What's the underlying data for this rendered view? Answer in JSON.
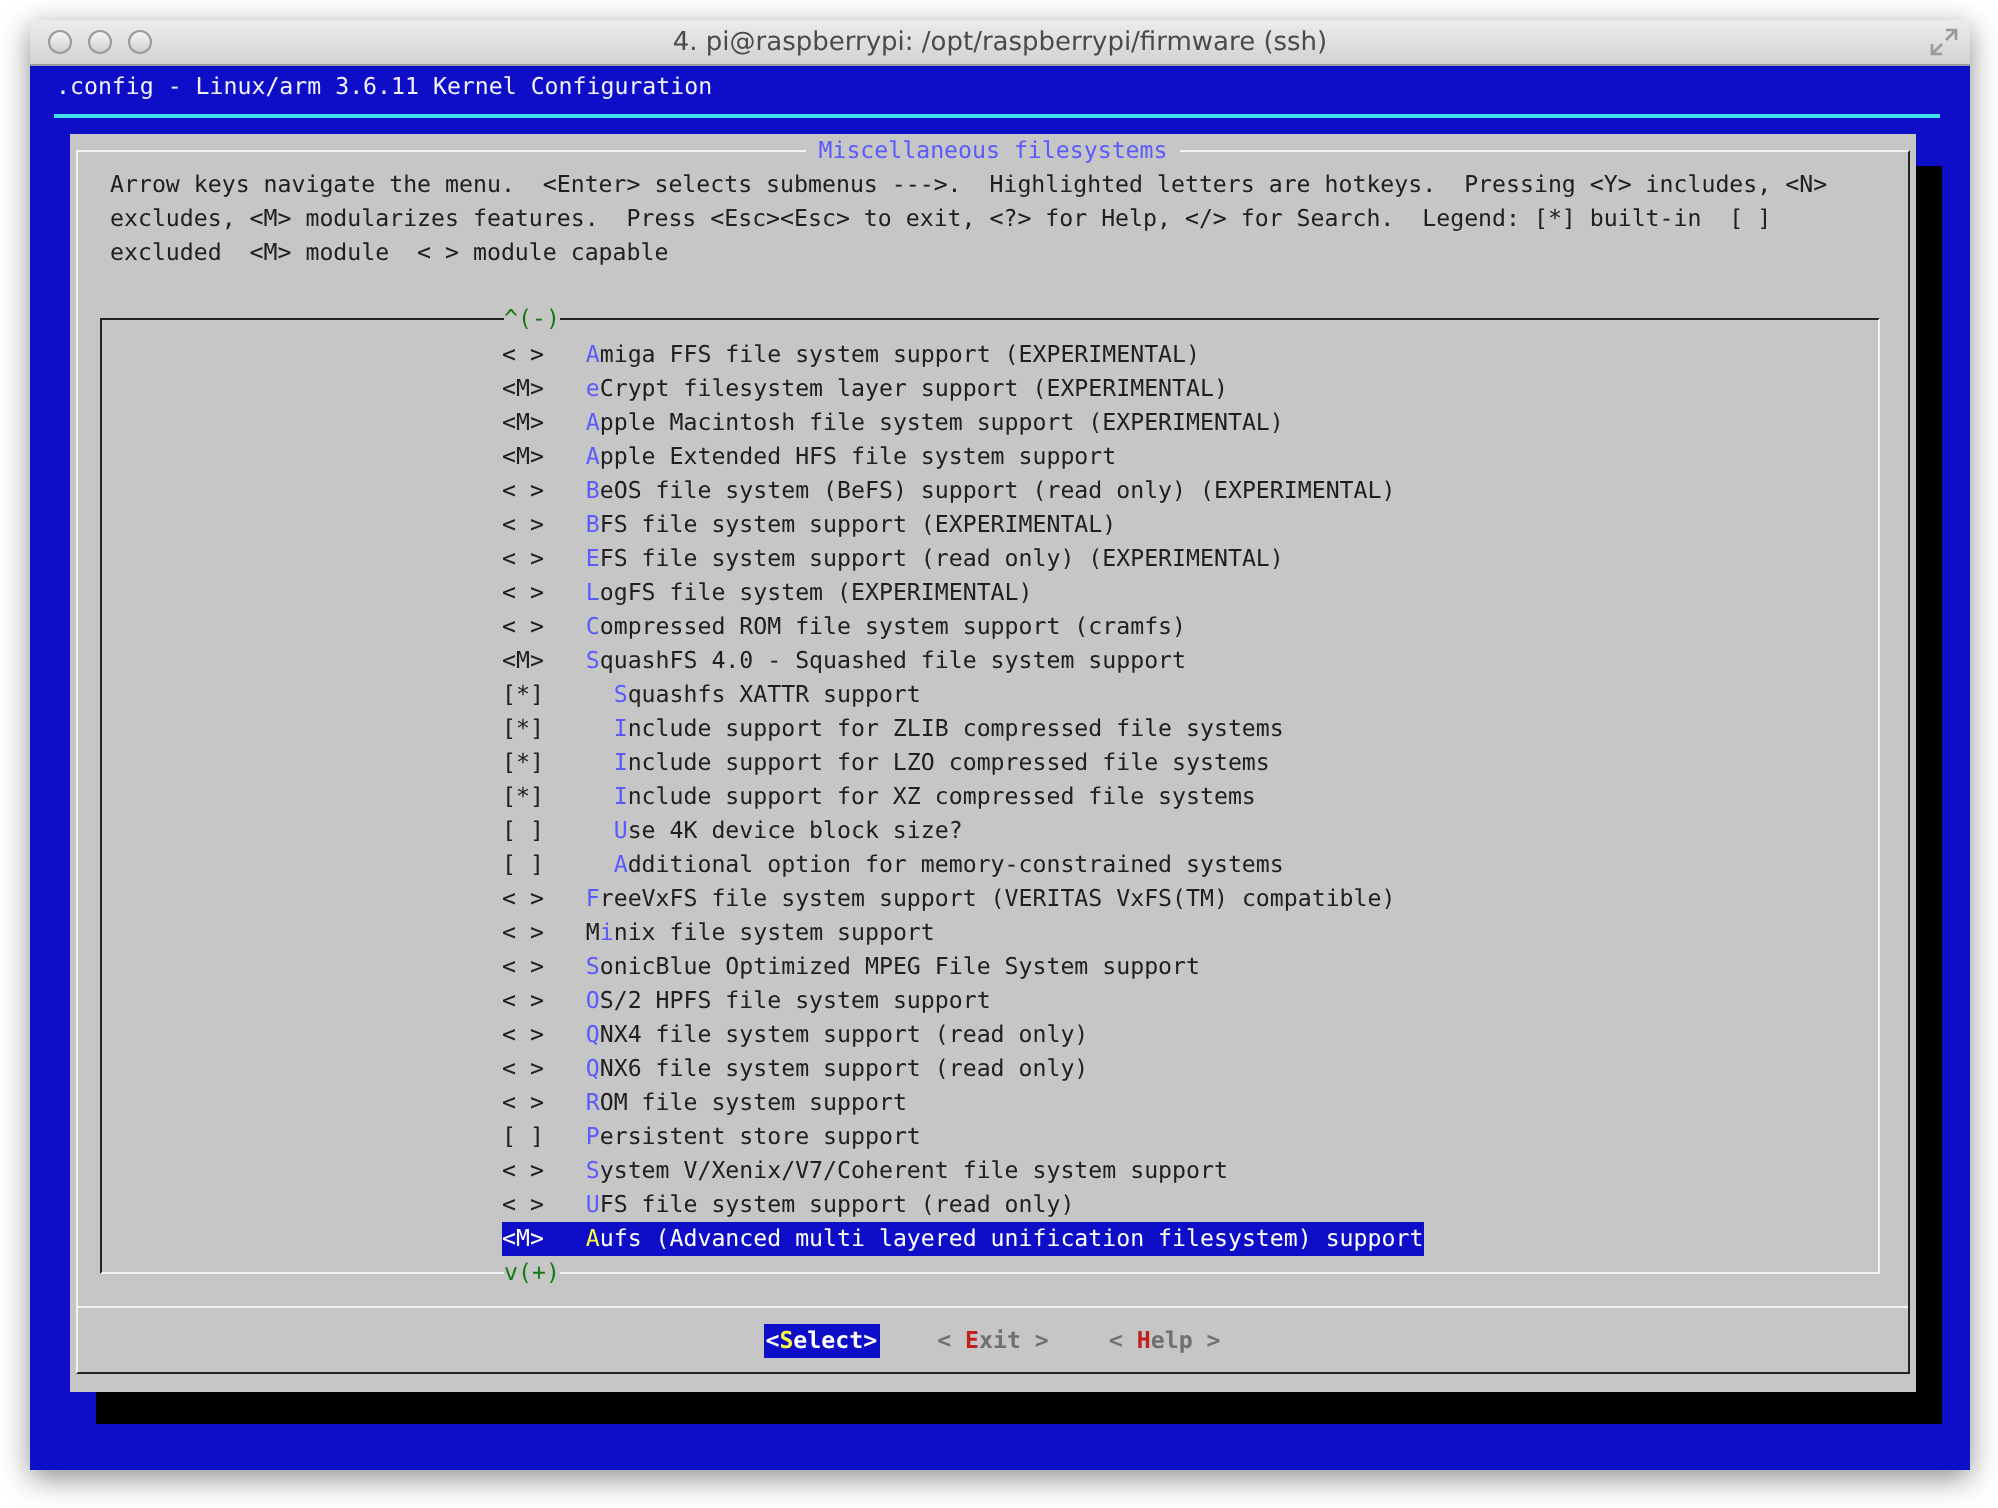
{
  "window": {
    "title": "4. pi@raspberrypi: /opt/raspberrypi/firmware (ssh)"
  },
  "header": ".config - Linux/arm 3.6.11 Kernel Configuration",
  "dialog": {
    "title": "Miscellaneous filesystems",
    "help_lines": [
      "Arrow keys navigate the menu.  <Enter> selects submenus --->.  Highlighted letters are hotkeys.  Pressing <Y> includes, <N>",
      "excludes, <M> modularizes features.  Press <Esc><Esc> to exit, <?> for Help, </> for Search.  Legend: [*] built-in  [ ]",
      "excluded  <M> module  < > module capable"
    ],
    "scroll_up": "^(-)",
    "scroll_down": "v(+)",
    "items": [
      {
        "marker": "< >",
        "hotkey": "A",
        "after": "miga FFS file system support (EXPERIMENTAL)",
        "selected": false
      },
      {
        "marker": "<M>",
        "hotkey": "e",
        "after": "Crypt filesystem layer support (EXPERIMENTAL)",
        "selected": false
      },
      {
        "marker": "<M>",
        "hotkey": "A",
        "after": "pple Macintosh file system support (EXPERIMENTAL)",
        "selected": false
      },
      {
        "marker": "<M>",
        "hotkey": "A",
        "after": "pple Extended HFS file system support",
        "selected": false
      },
      {
        "marker": "< >",
        "hotkey": "B",
        "after": "eOS file system (BeFS) support (read only) (EXPERIMENTAL)",
        "selected": false
      },
      {
        "marker": "< >",
        "hotkey": "B",
        "after": "FS file system support (EXPERIMENTAL)",
        "selected": false
      },
      {
        "marker": "< >",
        "hotkey": "E",
        "after": "FS file system support (read only) (EXPERIMENTAL)",
        "selected": false
      },
      {
        "marker": "< >",
        "hotkey": "L",
        "after": "ogFS file system (EXPERIMENTAL)",
        "selected": false
      },
      {
        "marker": "< >",
        "hotkey": "C",
        "after": "ompressed ROM file system support (cramfs)",
        "selected": false
      },
      {
        "marker": "<M>",
        "hotkey": "S",
        "after": "quashFS 4.0 - Squashed file system support",
        "selected": false,
        "children": [
          {
            "marker": "[*]",
            "hotkey": "S",
            "after": "quashfs XATTR support",
            "selected": false
          },
          {
            "marker": "[*]",
            "hotkey": "I",
            "after": "nclude support for ZLIB compressed file systems",
            "selected": false
          },
          {
            "marker": "[*]",
            "hotkey": "I",
            "after": "nclude support for LZO compressed file systems",
            "selected": false
          },
          {
            "marker": "[*]",
            "hotkey": "I",
            "after": "nclude support for XZ compressed file systems",
            "selected": false
          },
          {
            "marker": "[ ]",
            "hotkey": "U",
            "after": "se 4K device block size?",
            "selected": false
          },
          {
            "marker": "[ ]",
            "hotkey": "A",
            "after": "dditional option for memory-constrained systems",
            "selected": false
          }
        ]
      },
      {
        "marker": "< >",
        "hotkey": "F",
        "after": "reeVxFS file system support (VERITAS VxFS(TM) compatible)",
        "selected": false
      },
      {
        "marker": "< >",
        "before": "M",
        "hotkey": "i",
        "after": "nix file system support",
        "selected": false
      },
      {
        "marker": "< >",
        "hotkey": "S",
        "after": "onicBlue Optimized MPEG File System support",
        "selected": false
      },
      {
        "marker": "< >",
        "hotkey": "O",
        "after": "S/2 HPFS file system support",
        "selected": false
      },
      {
        "marker": "< >",
        "hotkey": "Q",
        "after": "NX4 file system support (read only)",
        "selected": false
      },
      {
        "marker": "< >",
        "hotkey": "Q",
        "after": "NX6 file system support (read only)",
        "selected": false
      },
      {
        "marker": "< >",
        "hotkey": "R",
        "after": "OM file system support",
        "selected": false
      },
      {
        "marker": "[ ]",
        "hotkey": "P",
        "after": "ersistent store support",
        "selected": false
      },
      {
        "marker": "< >",
        "hotkey": "S",
        "after": "ystem V/Xenix/V7/Coherent file system support",
        "selected": false
      },
      {
        "marker": "< >",
        "hotkey": "U",
        "after": "FS file system support (read only)",
        "selected": false
      },
      {
        "marker": "<M>",
        "hotkey": "A",
        "after": "ufs (Advanced multi layered unification filesystem) support",
        "selected": true
      }
    ],
    "buttons": [
      {
        "before": "<",
        "hotkey": "S",
        "after": "elect>",
        "selected": true
      },
      {
        "before": "< ",
        "hotkey": "E",
        "after": "xit >",
        "selected": false
      },
      {
        "before": "< ",
        "hotkey": "H",
        "after": "elp >",
        "selected": false
      }
    ]
  }
}
